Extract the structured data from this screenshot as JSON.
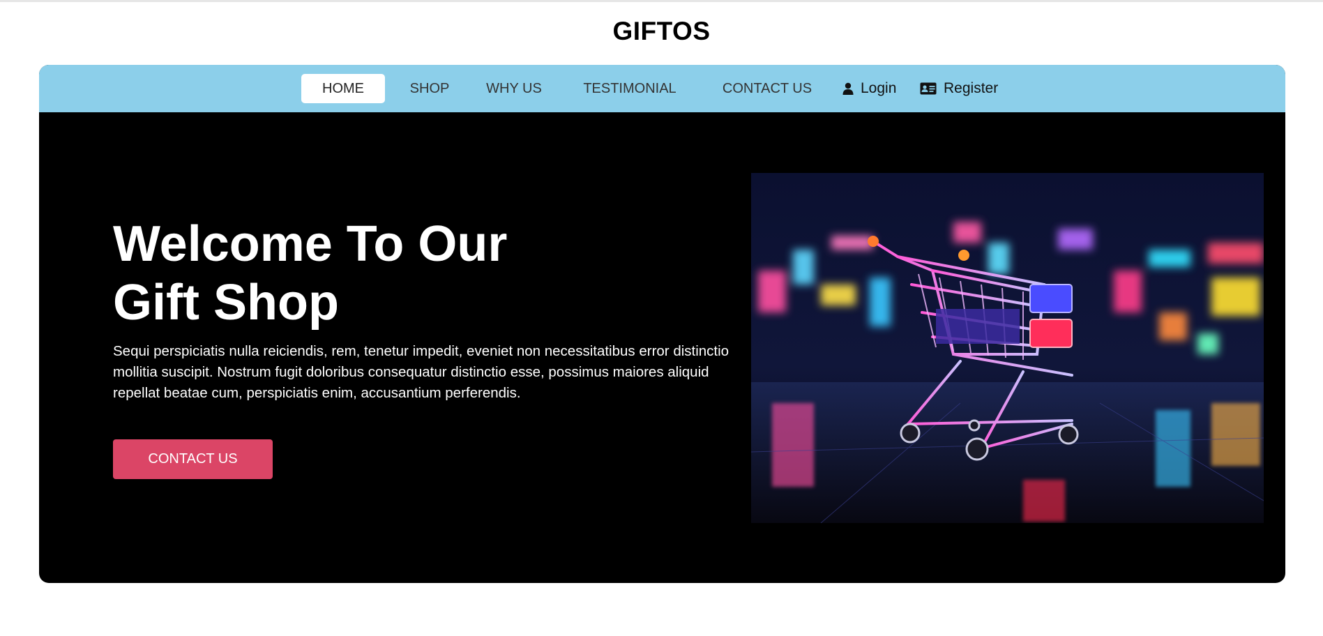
{
  "brand": {
    "name": "GIFTOS"
  },
  "nav": {
    "items": [
      {
        "label": "HOME",
        "active": true
      },
      {
        "label": "SHOP",
        "active": false
      },
      {
        "label": "WHY US",
        "active": false
      },
      {
        "label": "TESTIMONIAL",
        "active": false
      },
      {
        "label": "CONTACT US",
        "active": false
      }
    ],
    "login": {
      "label": "Login",
      "icon": "user-icon"
    },
    "register": {
      "label": "Register",
      "icon": "id-card-icon"
    }
  },
  "hero": {
    "title_line1": "Welcome To Our",
    "title_line2": "Gift Shop",
    "text": "Sequi perspiciatis nulla reiciendis, rem, tenetur impedit, eveniet non necessitatibus error distinctio mollitia suscipit. Nostrum fugit doloribus consequatur distinctio esse, possimus maiores aliquid repellat beatae cum, perspiciatis enim, accusantium perferendis.",
    "cta_label": "CONTACT US",
    "image": "neon-shopping-cart-photo"
  },
  "colors": {
    "navbar": "#8ccfea",
    "hero_bg": "#000000",
    "cta": "#db4566"
  }
}
